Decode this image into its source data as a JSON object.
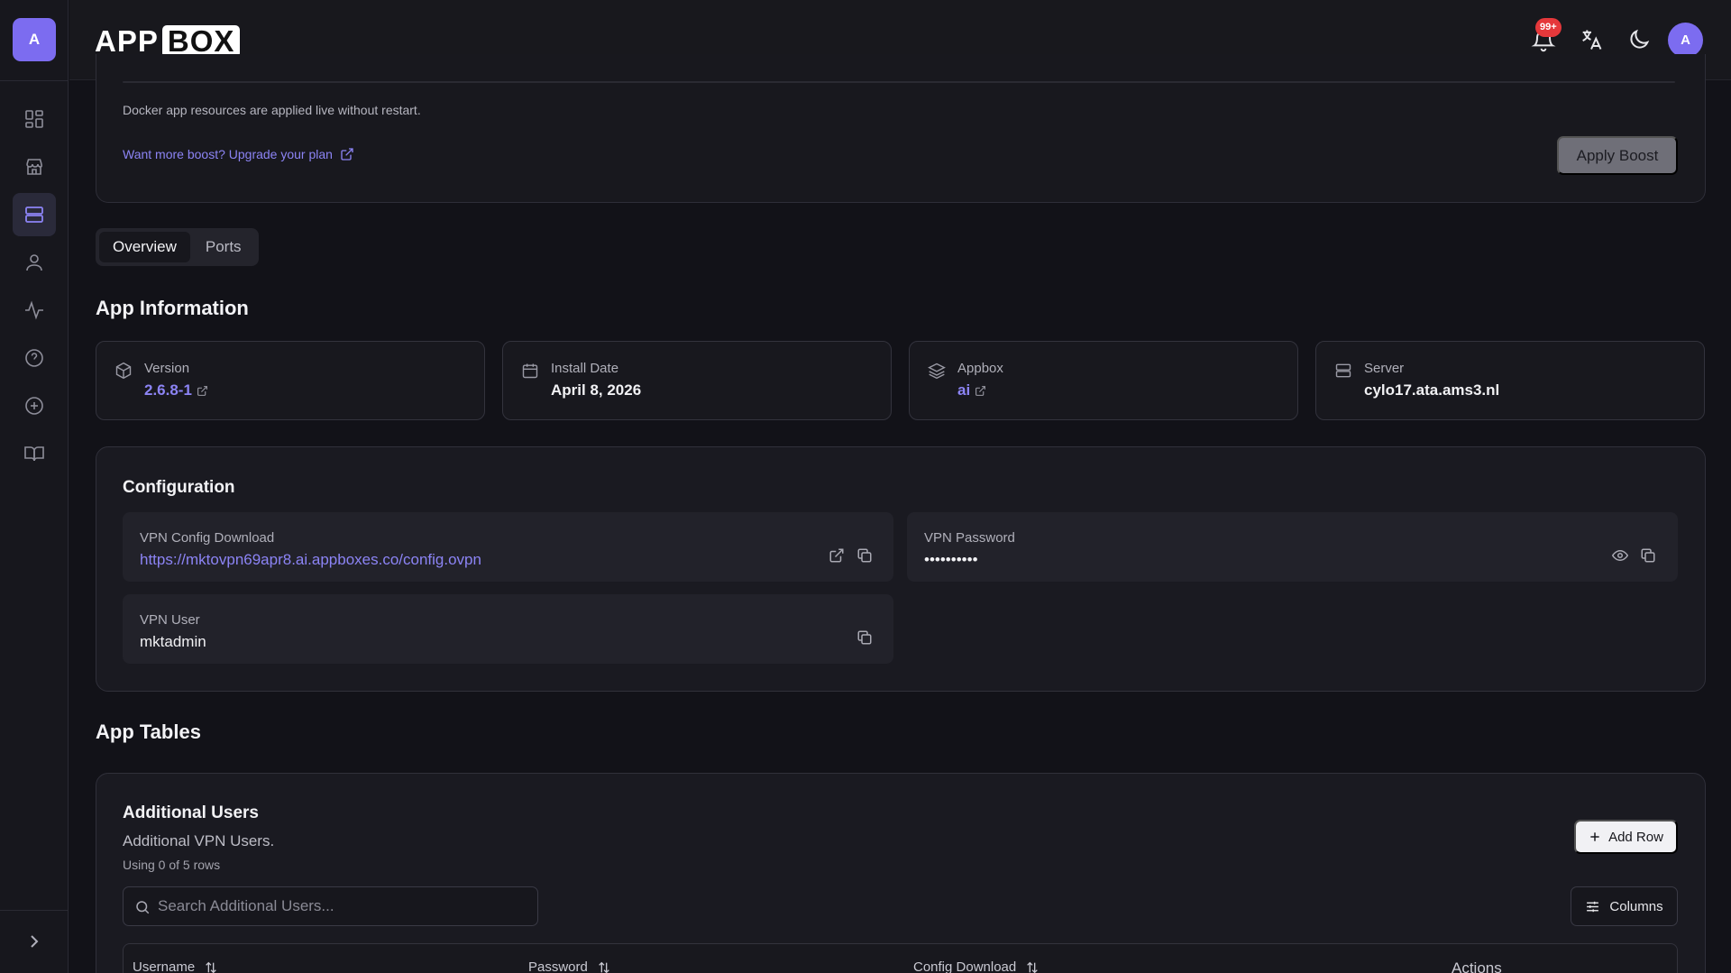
{
  "sidebar": {
    "avatar_initial": "A",
    "items": [
      {
        "icon": "dashboard-grid-icon",
        "active": false
      },
      {
        "icon": "store-icon",
        "active": false
      },
      {
        "icon": "server-icon",
        "active": true
      },
      {
        "icon": "user-icon",
        "active": false
      },
      {
        "icon": "activity-icon",
        "active": false
      },
      {
        "icon": "help-circle-icon",
        "active": false
      },
      {
        "icon": "plus-circle-icon",
        "active": false
      },
      {
        "icon": "book-open-icon",
        "active": false
      }
    ]
  },
  "header": {
    "logo_left": "APP",
    "logo_right": "BOX",
    "notification_badge": "99+",
    "avatar_initial": "A"
  },
  "boost": {
    "note": "Docker app resources are applied live without restart.",
    "upgrade_link": "Want more boost? Upgrade your plan",
    "apply_label": "Apply Boost"
  },
  "tabs": [
    {
      "label": "Overview",
      "active": true
    },
    {
      "label": "Ports",
      "active": false
    }
  ],
  "app_information": {
    "title": "App Information",
    "cards": [
      {
        "label": "Version",
        "value": "2.6.8-1",
        "icon": "package-icon",
        "link": true
      },
      {
        "label": "Install Date",
        "value": "April 8, 2026",
        "icon": "calendar-icon",
        "link": false
      },
      {
        "label": "Appbox",
        "value": "ai",
        "icon": "layers-icon",
        "link": true
      },
      {
        "label": "Server",
        "value": "cylo17.ata.ams3.nl",
        "icon": "server-icon",
        "link": false
      }
    ]
  },
  "configuration": {
    "title": "Configuration",
    "vpn_config": {
      "label": "VPN Config Download",
      "value": "https://mktovpn69apr8.ai.appboxes.co/config.ovpn"
    },
    "vpn_password": {
      "label": "VPN Password",
      "value": "••••••••••"
    },
    "vpn_user": {
      "label": "VPN User",
      "value": "mktadmin"
    }
  },
  "app_tables": {
    "title": "App Tables",
    "table_title": "Additional Users",
    "table_subtitle": "Additional VPN Users.",
    "usage": "Using 0 of 5 rows",
    "add_row_label": "Add Row",
    "search_placeholder": "Search Additional Users...",
    "columns_label": "Columns",
    "headers": [
      "Username",
      "Password",
      "Config Download",
      "Actions"
    ]
  },
  "colors": {
    "accent": "#8c84f5",
    "avatar": "#7c6cf0",
    "badge": "#e5383b",
    "background": "#121218"
  }
}
